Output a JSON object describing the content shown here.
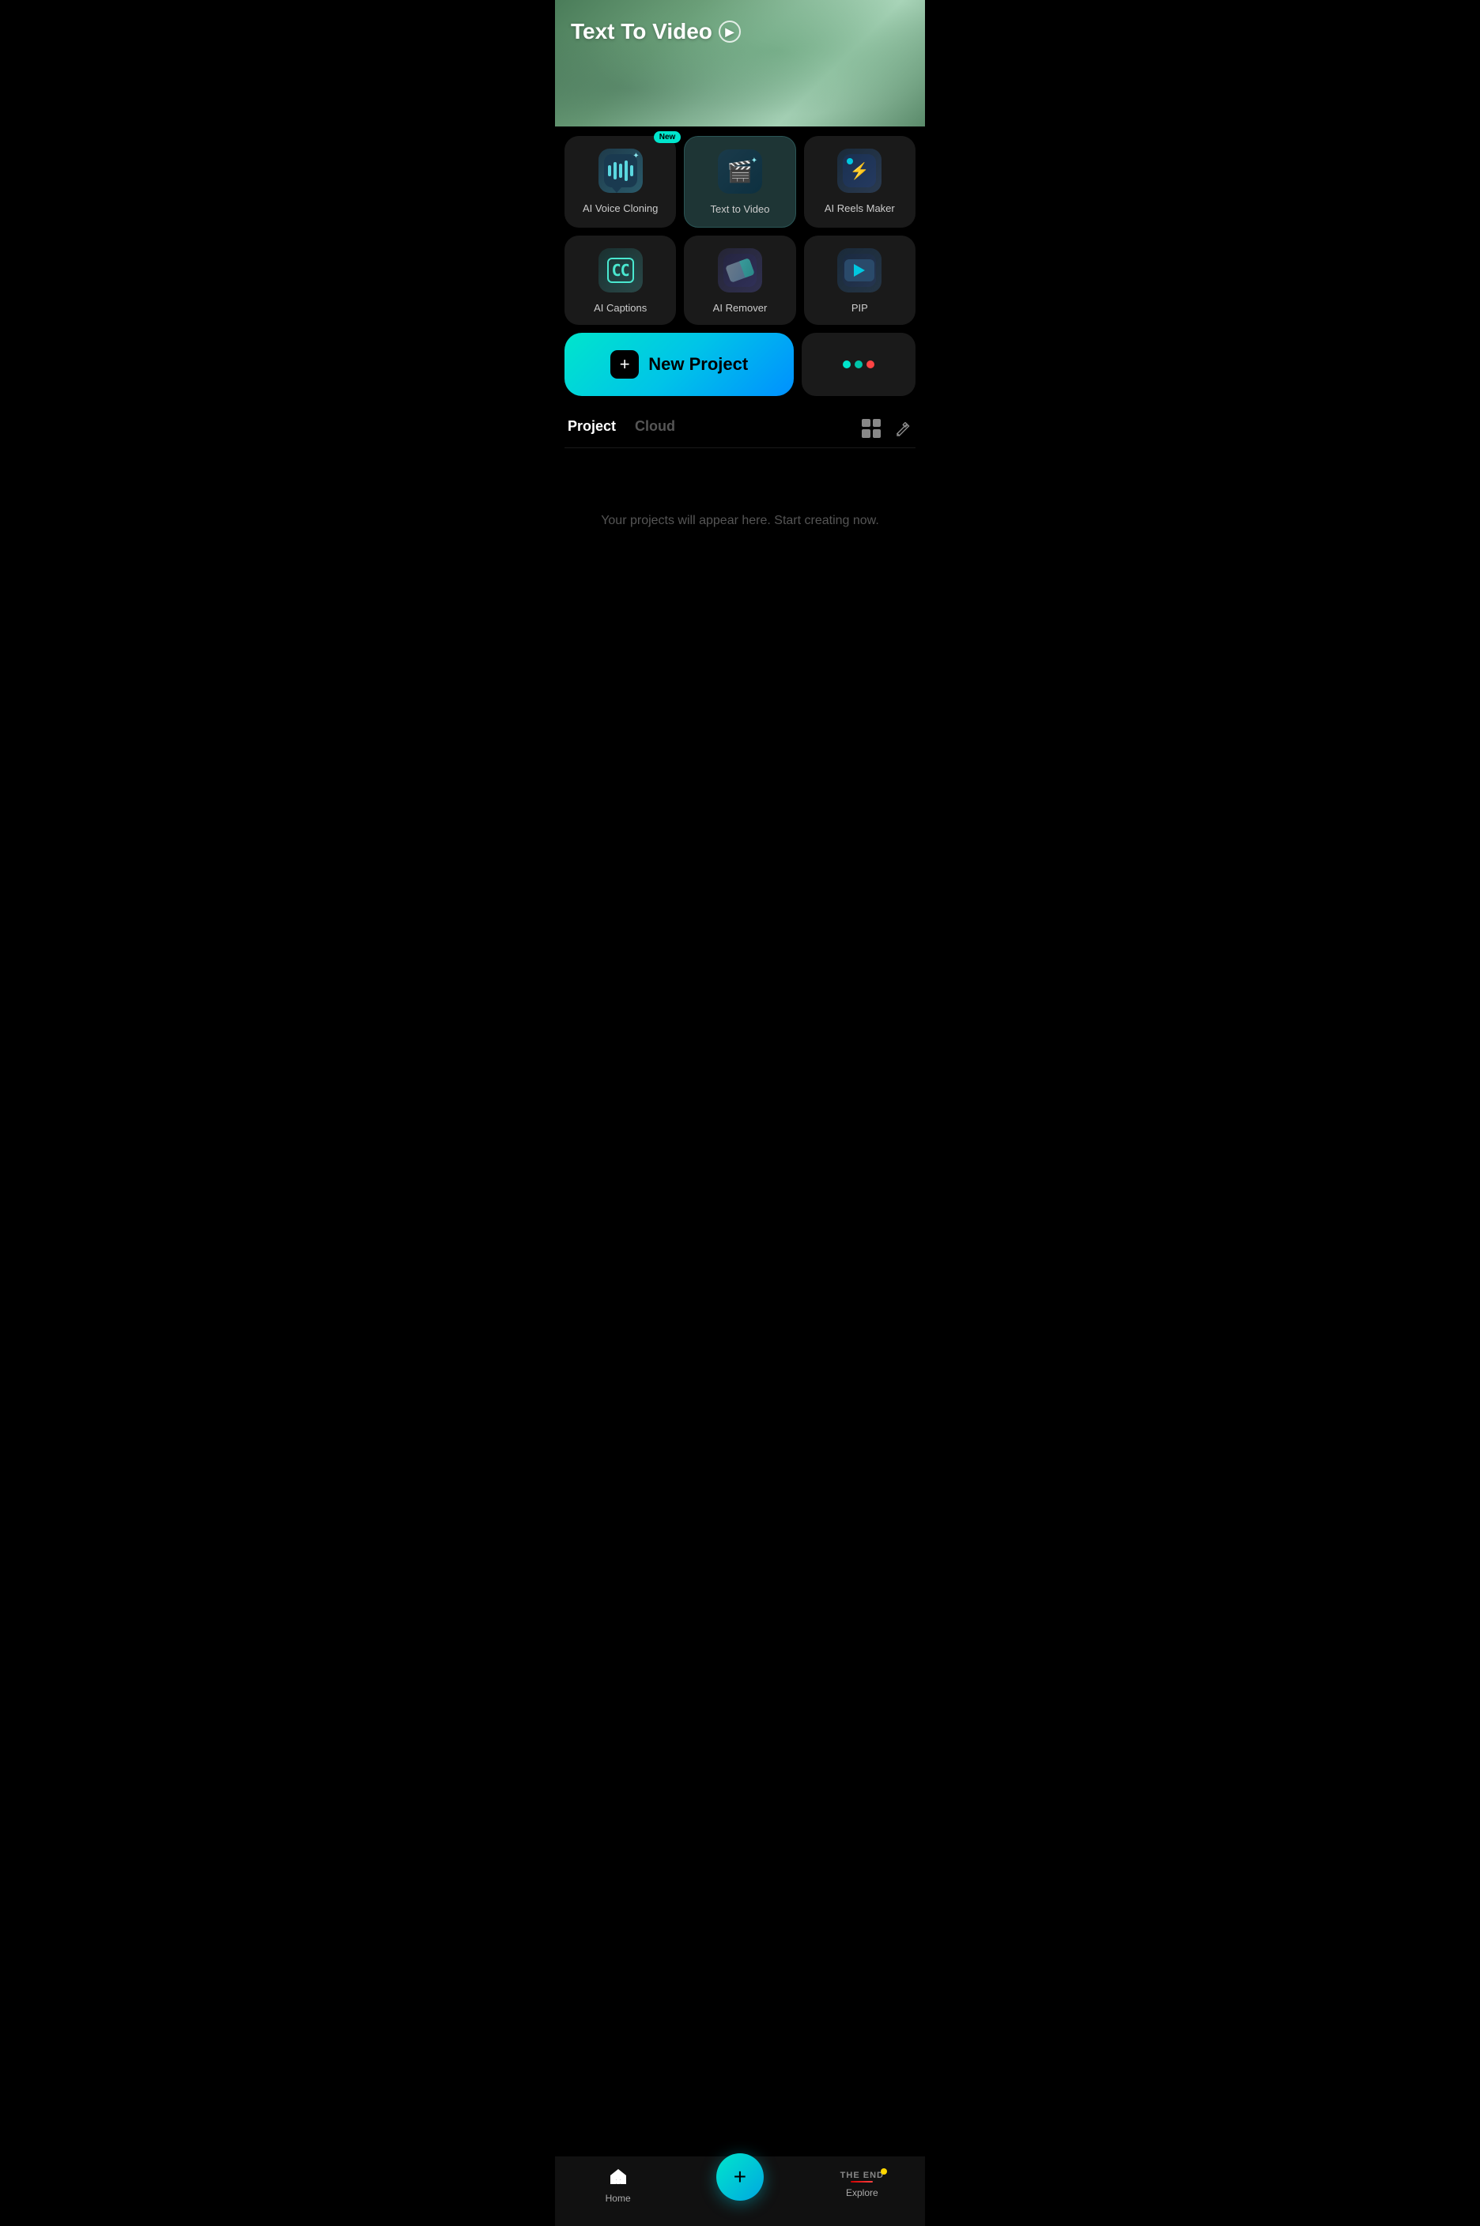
{
  "hero": {
    "title": "Text To Video",
    "title_icon": "▶"
  },
  "tools": [
    {
      "id": "ai-voice-cloning",
      "label": "AI Voice Cloning",
      "icon_type": "voice",
      "is_new": true,
      "selected": false
    },
    {
      "id": "text-to-video",
      "label": "Text  to Video",
      "icon_type": "video",
      "is_new": false,
      "selected": true
    },
    {
      "id": "ai-reels-maker",
      "label": "AI Reels Maker",
      "icon_type": "reels",
      "is_new": false,
      "selected": false
    },
    {
      "id": "ai-captions",
      "label": "AI Captions",
      "icon_type": "captions",
      "is_new": false,
      "selected": false
    },
    {
      "id": "ai-remover",
      "label": "AI Remover",
      "icon_type": "remover",
      "is_new": false,
      "selected": false
    },
    {
      "id": "pip",
      "label": "PIP",
      "icon_type": "pip",
      "is_new": false,
      "selected": false
    }
  ],
  "new_project": {
    "label": "New Project",
    "icon": "+"
  },
  "more_button": {
    "label": "More"
  },
  "tabs": [
    {
      "id": "project",
      "label": "Project",
      "active": true
    },
    {
      "id": "cloud",
      "label": "Cloud",
      "active": false
    }
  ],
  "empty_state": {
    "text": "Your projects will appear here. Start creating now."
  },
  "bottom_nav": [
    {
      "id": "home",
      "label": "Home",
      "icon": "🏠",
      "active": true
    },
    {
      "id": "create",
      "label": "",
      "icon": "+",
      "is_center": true
    },
    {
      "id": "explore",
      "label": "Explore",
      "icon": "explore",
      "active": false
    }
  ],
  "colors": {
    "accent_cyan": "#00e5cc",
    "accent_blue": "#0090ff",
    "new_badge": "#00e5cc",
    "bg_dark": "#1a1a1a",
    "bg_black": "#000000"
  }
}
